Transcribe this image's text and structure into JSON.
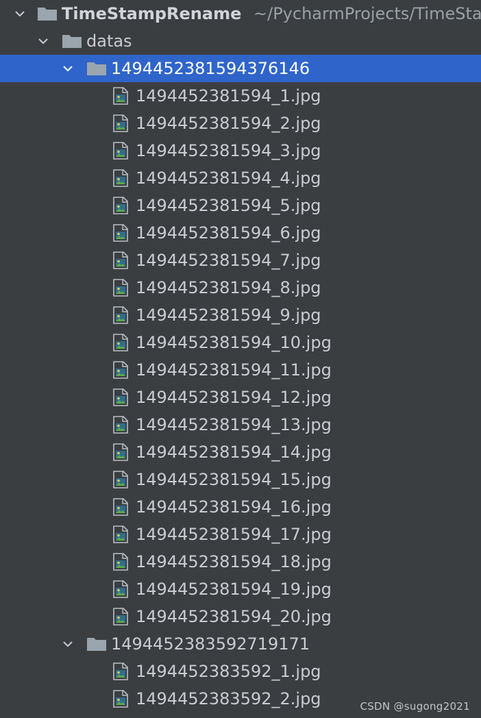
{
  "colors": {
    "background": "#3b3e41",
    "selection": "#2f65ca",
    "folder": "#9aa5ae",
    "text": "#c9cdd1"
  },
  "root": {
    "name": "TimeStampRename",
    "path": "~/PycharmProjects/TimeSta"
  },
  "datas_folder": {
    "name": "datas"
  },
  "folder1": {
    "name": "1494452381594376146",
    "selected": true,
    "files": [
      "1494452381594_1.jpg",
      "1494452381594_2.jpg",
      "1494452381594_3.jpg",
      "1494452381594_4.jpg",
      "1494452381594_5.jpg",
      "1494452381594_6.jpg",
      "1494452381594_7.jpg",
      "1494452381594_8.jpg",
      "1494452381594_9.jpg",
      "1494452381594_10.jpg",
      "1494452381594_11.jpg",
      "1494452381594_12.jpg",
      "1494452381594_13.jpg",
      "1494452381594_14.jpg",
      "1494452381594_15.jpg",
      "1494452381594_16.jpg",
      "1494452381594_17.jpg",
      "1494452381594_18.jpg",
      "1494452381594_19.jpg",
      "1494452381594_20.jpg"
    ]
  },
  "folder2": {
    "name": "1494452383592719171",
    "files": [
      "1494452383592_1.jpg",
      "1494452383592_2.jpg"
    ]
  },
  "watermark": "CSDN @sugong2021"
}
